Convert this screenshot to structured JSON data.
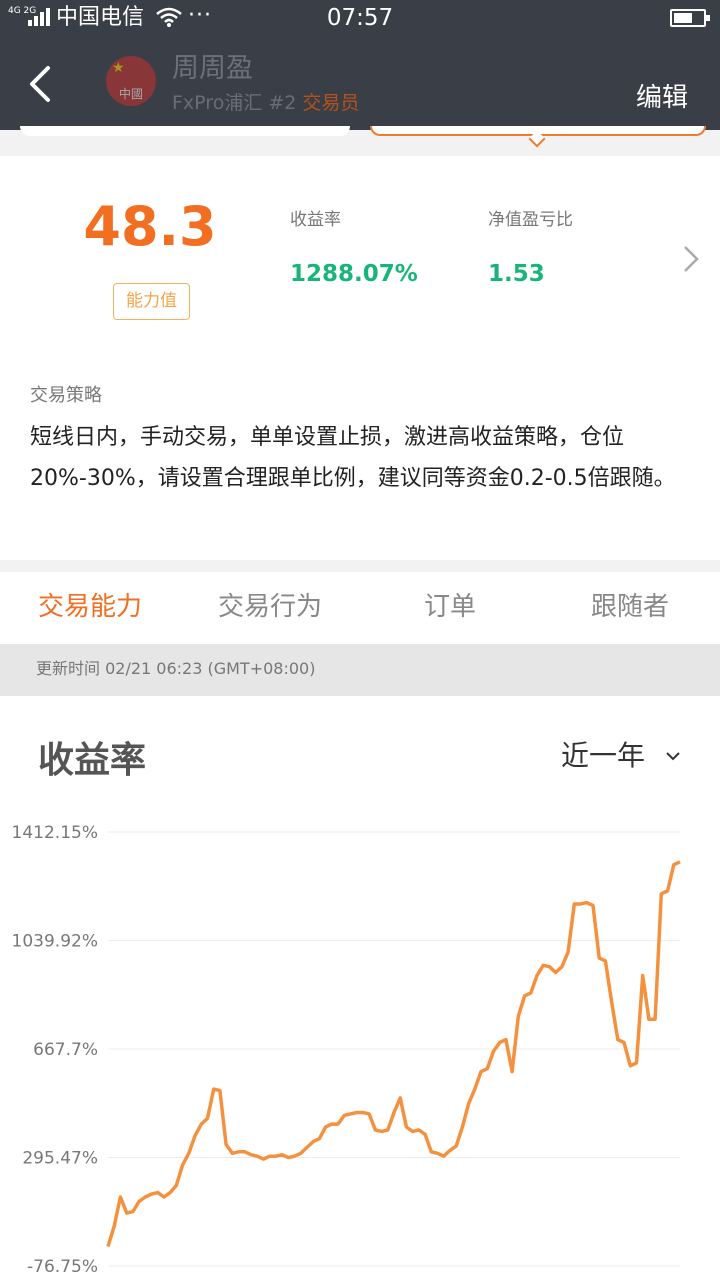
{
  "status_bar": {
    "network": "4G 2G",
    "carrier": "中国电信",
    "more": "···",
    "time": "07:57"
  },
  "header": {
    "back_icon": "chevron-left-icon",
    "name": "周周盈",
    "broker": "FxPro浦汇 #2",
    "role": "交易员",
    "edit_label": "编辑",
    "avatar_label": "中國"
  },
  "summary": {
    "score": "48.3",
    "score_label": "能力值",
    "return_label": "收益率",
    "return_value": "1288.07%",
    "ratio_label": "净值盈亏比",
    "ratio_value": "1.53",
    "strategy_title": "交易策略",
    "strategy_text": "短线日内，手动交易，单单设置止损，激进高收益策略，仓位20%-30%，请设置合理跟单比例，建议同等资金0.2-0.5倍跟随。"
  },
  "tabs": [
    {
      "label": "交易能力",
      "active": true
    },
    {
      "label": "交易行为",
      "active": false
    },
    {
      "label": "订单",
      "active": false
    },
    {
      "label": "跟随者",
      "active": false
    }
  ],
  "update_time": "更新时间 02/21 06:23 (GMT+08:00)",
  "colors": {
    "accent": "#f26f21",
    "positive": "#17b578",
    "header_bg": "#3a3e47",
    "line": "#f5913e"
  },
  "chart": {
    "title": "收益率",
    "range_label": "近一年"
  },
  "chart_data": {
    "type": "line",
    "title": "收益率",
    "ylim": [
      -76.75,
      1412.15
    ],
    "y_ticks": [
      "1412.15%",
      "1039.92%",
      "667.7%",
      "295.47%",
      "-76.75%"
    ],
    "y_tick_values": [
      1412.15,
      1039.92,
      667.7,
      295.47,
      -76.75
    ],
    "grid": true,
    "series": [
      {
        "values": [
          -10,
          60,
          160,
          105,
          110,
          145,
          160,
          170,
          175,
          160,
          175,
          200,
          270,
          310,
          370,
          410,
          430,
          530,
          525,
          340,
          310,
          315,
          315,
          305,
          300,
          290,
          300,
          300,
          305,
          295,
          300,
          310,
          330,
          350,
          360,
          400,
          410,
          410,
          440,
          445,
          450,
          450,
          445,
          390,
          385,
          390,
          450,
          500,
          400,
          385,
          390,
          375,
          315,
          310,
          300,
          320,
          335,
          400,
          480,
          530,
          590,
          600,
          660,
          690,
          700,
          590,
          780,
          850,
          860,
          920,
          955,
          950,
          930,
          950,
          1000,
          1165,
          1165,
          1170,
          1160,
          980,
          970,
          830,
          700,
          690,
          610,
          620,
          920,
          770,
          770,
          1200,
          1210,
          1300,
          1310
        ]
      }
    ]
  }
}
